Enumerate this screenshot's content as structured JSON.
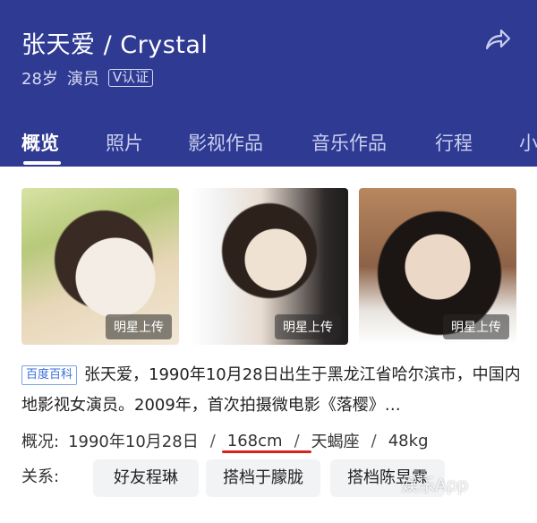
{
  "profile": {
    "name": "张天爱 / Crystal",
    "age": "28岁",
    "occupation": "演员",
    "verified_badge": "V认证"
  },
  "icons": {
    "share": "share-icon"
  },
  "tabs": [
    "概览",
    "照片",
    "影视作品",
    "音乐作品",
    "行程",
    "小"
  ],
  "active_tab": 0,
  "photos": [
    {
      "tag": "明星上传"
    },
    {
      "tag": "明星上传"
    },
    {
      "tag": "明星上传"
    }
  ],
  "intro": {
    "source_badge": "百度百科",
    "text": "张天爱，1990年10月28日出生于黑龙江省哈尔滨市，中国内地影视女演员。2009年，首次拍摄微电影《落樱》…"
  },
  "facts": {
    "label": "概况:",
    "birthday": "1990年10月28日",
    "height": "168cm",
    "zodiac": "天蝎座",
    "weight": "48kg"
  },
  "relations": {
    "label": "关系:",
    "items": [
      "好友程琳",
      "搭档于朦胧",
      "搭档陈昱霖"
    ]
  },
  "watermark": "娱乐App",
  "colors": {
    "header_bg": "#2f3a93",
    "highlight": "#d6231f",
    "source_badge": "#3a6fd8"
  }
}
